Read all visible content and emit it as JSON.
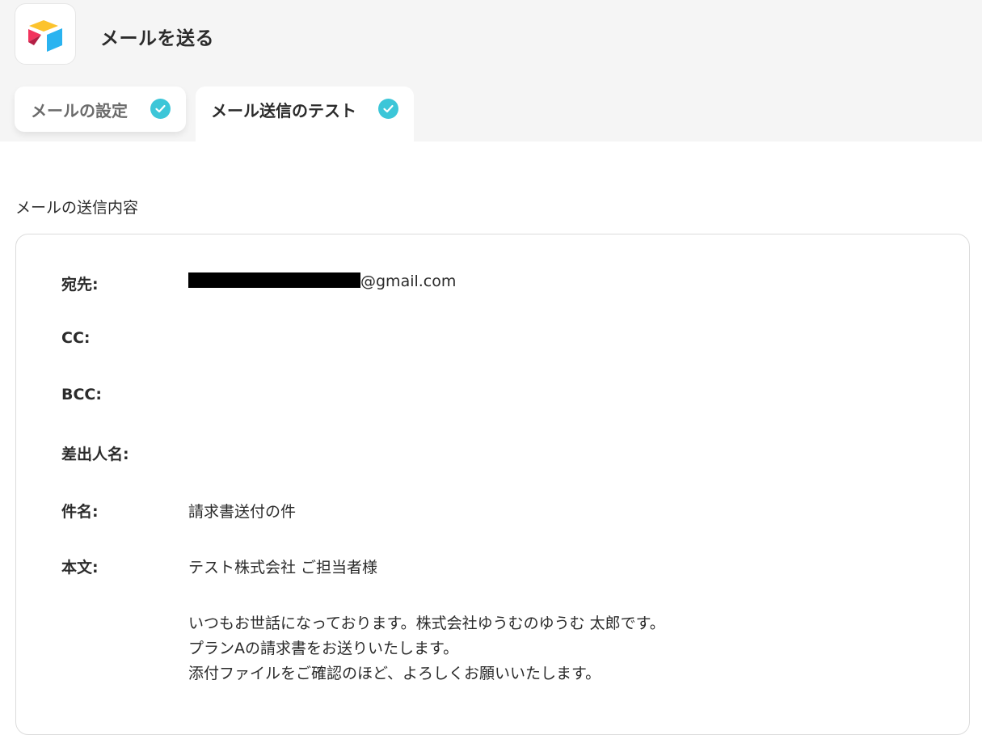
{
  "header": {
    "app_icon": "airtable-logo-icon",
    "title": "メールを送る"
  },
  "tabs": [
    {
      "label": "メールの設定",
      "completed": true,
      "active": false
    },
    {
      "label": "メール送信のテスト",
      "completed": true,
      "active": true
    }
  ],
  "section": {
    "title": "メールの送信内容"
  },
  "fields": {
    "to": {
      "label": "宛先:",
      "value_suffix": "@gmail.com",
      "redacted": true
    },
    "cc": {
      "label": "CC:",
      "value": ""
    },
    "bcc": {
      "label": "BCC:",
      "value": ""
    },
    "sender": {
      "label": "差出人名:",
      "value": ""
    },
    "subject": {
      "label": "件名:",
      "value": "請求書送付の件"
    },
    "body": {
      "label": "本文:",
      "lines": [
        "テスト株式会社 ご担当者様",
        "",
        "いつもお世話になっております。株式会社ゆうむのゆうむ 太郎です。",
        "プランAの請求書をお送りいたします。",
        "添付ファイルをご確認のほど、よろしくお願いいたします。"
      ]
    }
  },
  "colors": {
    "accent_check": "#3cc6d8",
    "header_bg": "#f5f5f5",
    "text": "#2b2b2b"
  }
}
